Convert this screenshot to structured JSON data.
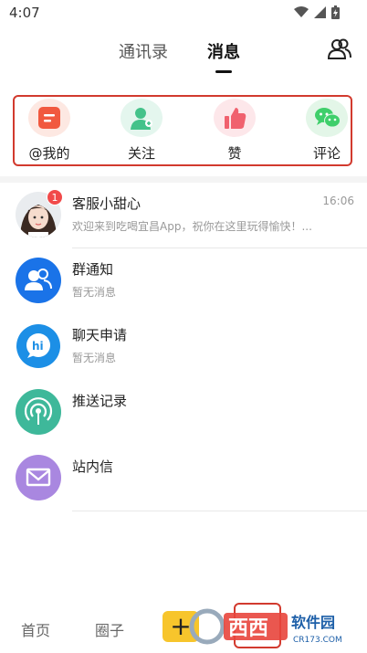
{
  "status_bar": {
    "time": "4:07"
  },
  "header": {
    "tabs": [
      {
        "label": "通讯录"
      },
      {
        "label": "消息"
      }
    ]
  },
  "shortcuts": [
    {
      "label": "@我的",
      "icon": "mention-icon",
      "color": "#f1593f"
    },
    {
      "label": "关注",
      "icon": "follow-user-icon",
      "color": "#44c28a"
    },
    {
      "label": "赞",
      "icon": "thumbs-up-icon",
      "color": "#f0616e"
    },
    {
      "label": "评论",
      "icon": "wechat-comment-icon",
      "color": "#3fcf6b"
    }
  ],
  "messages": [
    {
      "title": "客服小甜心",
      "preview": "欢迎来到吃喝宜昌App，祝你在这里玩得愉快！...",
      "time": "16:06",
      "badge": "1"
    },
    {
      "title": "群通知",
      "preview": "暂无消息"
    },
    {
      "title": "聊天申请",
      "preview": "暂无消息"
    },
    {
      "title": "推送记录",
      "preview": ""
    },
    {
      "title": "站内信",
      "preview": ""
    }
  ],
  "bottom_nav": {
    "home": "首页",
    "circle": "圈子",
    "plus": "+"
  },
  "watermark": {
    "brand": "西西",
    "name": "软件园",
    "url": "CR173.COM"
  }
}
